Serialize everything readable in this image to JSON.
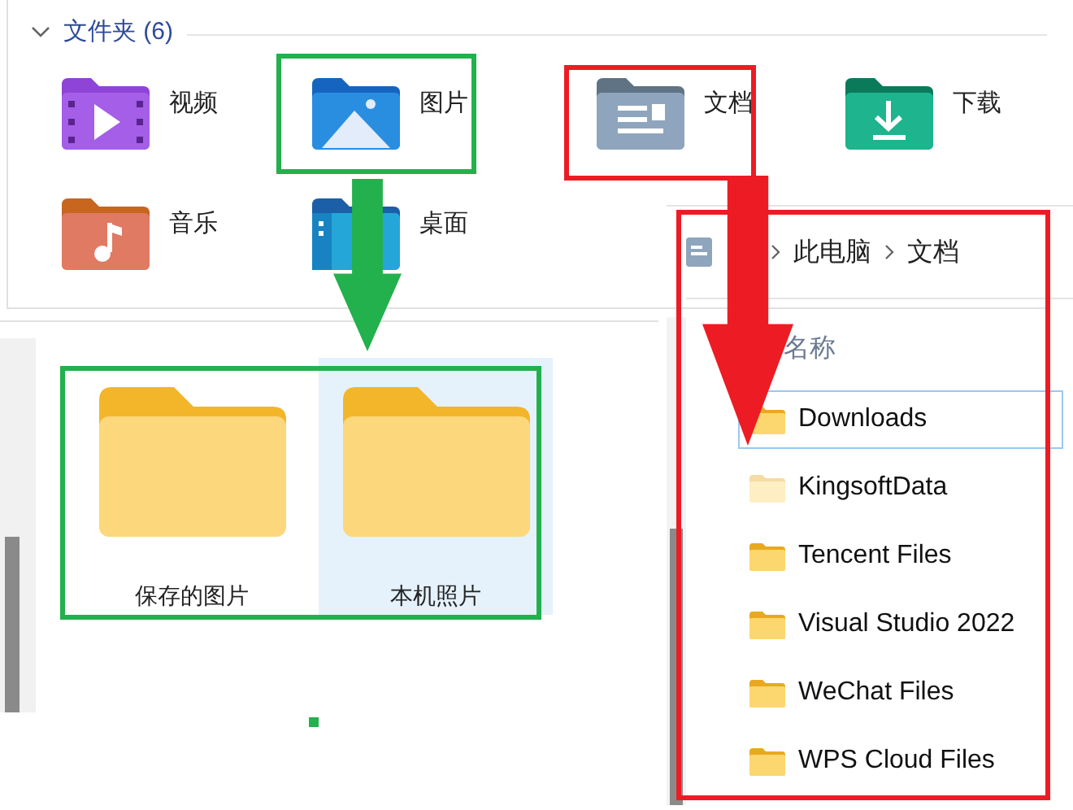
{
  "section": {
    "title": "文件夹 (6)",
    "expanded": true
  },
  "libraries": [
    {
      "kind": "video",
      "label": "视频"
    },
    {
      "kind": "pictures",
      "label": "图片"
    },
    {
      "kind": "documents",
      "label": "文档"
    },
    {
      "kind": "downloads",
      "label": "下载"
    },
    {
      "kind": "music",
      "label": "音乐"
    },
    {
      "kind": "desktop",
      "label": "桌面"
    }
  ],
  "subfolders": [
    {
      "label": "保存的图片",
      "selected": false
    },
    {
      "label": "本机照片",
      "selected": true
    }
  ],
  "explorer": {
    "breadcrumb": [
      "此电脑",
      "文档"
    ],
    "column": "名称",
    "files": [
      {
        "name": "Downloads",
        "selected": true,
        "hidden": false
      },
      {
        "name": "KingsoftData",
        "selected": false,
        "hidden": true
      },
      {
        "name": "Tencent Files",
        "selected": false,
        "hidden": false
      },
      {
        "name": "Visual Studio 2022",
        "selected": false,
        "hidden": false
      },
      {
        "name": "WeChat Files",
        "selected": false,
        "hidden": false
      },
      {
        "name": "WPS Cloud Files",
        "selected": false,
        "hidden": false
      }
    ]
  },
  "annotations": [
    {
      "kind": "box",
      "color": "#22b14c"
    },
    {
      "kind": "arrow",
      "color": "#22b14c"
    },
    {
      "kind": "box",
      "color": "#22b14c"
    },
    {
      "kind": "dot",
      "color": "#22b14c"
    },
    {
      "kind": "box",
      "color": "#ed1c24"
    },
    {
      "kind": "arrow",
      "color": "#ed1c24"
    },
    {
      "kind": "box",
      "color": "#ed1c24"
    }
  ]
}
